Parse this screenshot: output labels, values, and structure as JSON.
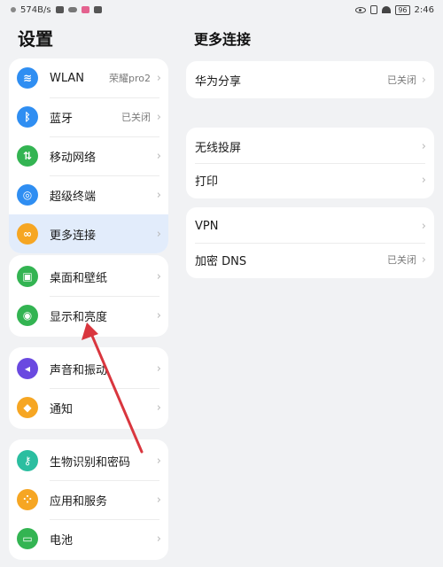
{
  "status_bar": {
    "speed": "574B/s",
    "battery": "96",
    "time": "2:46"
  },
  "settings": {
    "title": "设置",
    "groups": [
      [
        {
          "label": "WLAN",
          "value": "荣耀pro2",
          "icon": "wifi-icon",
          "color": "#2f8ef2"
        },
        {
          "label": "蓝牙",
          "value": "已关闭",
          "icon": "bluetooth-icon",
          "color": "#2f8ef2"
        },
        {
          "label": "移动网络",
          "value": "",
          "icon": "mobile-data-icon",
          "color": "#33b452"
        },
        {
          "label": "超级终端",
          "value": "",
          "icon": "super-device-icon",
          "color": "#2f8ef2"
        },
        {
          "label": "更多连接",
          "value": "",
          "icon": "link-icon",
          "color": "#f6a623",
          "active": true
        }
      ],
      [
        {
          "label": "桌面和壁纸",
          "value": "",
          "icon": "wallpaper-icon",
          "color": "#33b452"
        },
        {
          "label": "显示和亮度",
          "value": "",
          "icon": "eye-icon",
          "color": "#33b452"
        }
      ],
      [
        {
          "label": "声音和振动",
          "value": "",
          "icon": "sound-icon",
          "color": "#6a49e0"
        },
        {
          "label": "通知",
          "value": "",
          "icon": "bell-icon",
          "color": "#f6a623"
        }
      ],
      [
        {
          "label": "生物识别和密码",
          "value": "",
          "icon": "key-icon",
          "color": "#2bbea0"
        },
        {
          "label": "应用和服务",
          "value": "",
          "icon": "apps-icon",
          "color": "#f6a623"
        },
        {
          "label": "电池",
          "value": "",
          "icon": "battery-icon",
          "color": "#33b452"
        }
      ]
    ]
  },
  "more_connections": {
    "title": "更多连接",
    "groups": [
      [
        {
          "label": "华为分享",
          "value": "已关闭"
        }
      ],
      [
        {
          "label": "无线投屏",
          "value": ""
        },
        {
          "label": "打印",
          "value": ""
        }
      ],
      [
        {
          "label": "VPN",
          "value": ""
        },
        {
          "label": "加密 DNS",
          "value": "已关闭"
        }
      ]
    ]
  },
  "chevron": "›",
  "annotation_color": "#d9363e"
}
